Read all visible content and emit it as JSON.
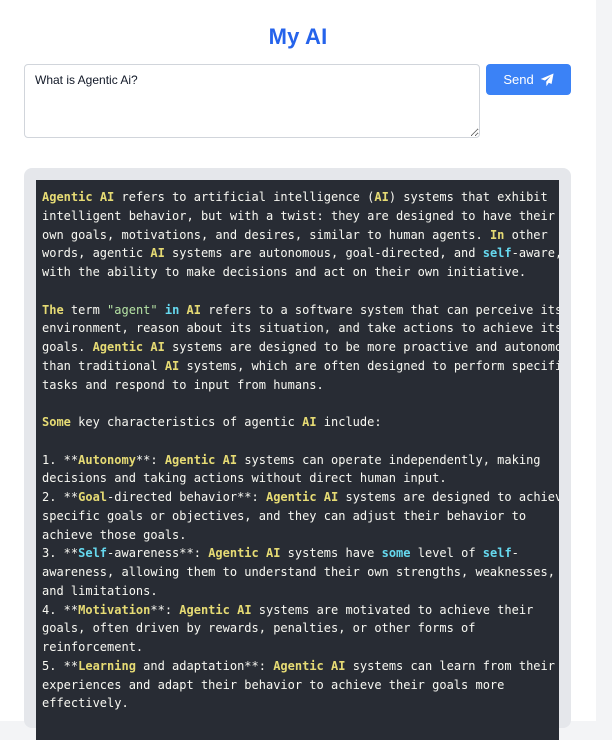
{
  "header": {
    "title": "My AI"
  },
  "prompt": {
    "value": "What is Agentic Ai?",
    "placeholder": ""
  },
  "send_button": {
    "label": "Send",
    "icon": "paper-plane-icon"
  },
  "colors": {
    "title": "#2563eb",
    "button": "#3b82f6",
    "code_bg": "#282c34",
    "highlight_yellow": "#e6db74",
    "highlight_blue": "#66d9ef"
  },
  "response_lines": [
    [
      {
        "t": "Agentic",
        "c": "y"
      },
      {
        "t": " "
      },
      {
        "t": "AI",
        "c": "y"
      },
      {
        "t": " refers to artificial intelligence ("
      },
      {
        "t": "AI",
        "c": "y"
      },
      {
        "t": ") systems that exhibit"
      }
    ],
    [
      {
        "t": "intelligent behavior, but with a twist: they are designed to have their"
      }
    ],
    [
      {
        "t": "own goals, motivations, and desires, similar to human agents. "
      },
      {
        "t": "In",
        "c": "y"
      },
      {
        "t": " other"
      }
    ],
    [
      {
        "t": "words, agentic "
      },
      {
        "t": "AI",
        "c": "y"
      },
      {
        "t": " systems are autonomous, goal-directed, and "
      },
      {
        "t": "self",
        "c": "b"
      },
      {
        "t": "-aware,"
      }
    ],
    [
      {
        "t": "with the ability to make decisions and act on their own initiative."
      }
    ],
    [
      {
        "t": ""
      }
    ],
    [
      {
        "t": "The",
        "c": "y"
      },
      {
        "t": " term "
      },
      {
        "t": "\"agent\"",
        "c": "s"
      },
      {
        "t": " "
      },
      {
        "t": "in",
        "c": "b"
      },
      {
        "t": " "
      },
      {
        "t": "AI",
        "c": "y"
      },
      {
        "t": " refers to a software system that can perceive its"
      }
    ],
    [
      {
        "t": "environment, reason about its situation, and take actions to achieve its"
      }
    ],
    [
      {
        "t": "goals. "
      },
      {
        "t": "Agentic",
        "c": "y"
      },
      {
        "t": " "
      },
      {
        "t": "AI",
        "c": "y"
      },
      {
        "t": " systems are designed to be more proactive and autonomous"
      }
    ],
    [
      {
        "t": "than traditional "
      },
      {
        "t": "AI",
        "c": "y"
      },
      {
        "t": " systems, which are often designed to perform specific"
      }
    ],
    [
      {
        "t": "tasks and respond to input from humans."
      }
    ],
    [
      {
        "t": ""
      }
    ],
    [
      {
        "t": "Some",
        "c": "y"
      },
      {
        "t": " key characteristics of agentic "
      },
      {
        "t": "AI",
        "c": "y"
      },
      {
        "t": " include:"
      }
    ],
    [
      {
        "t": ""
      }
    ],
    [
      {
        "t": "1. **"
      },
      {
        "t": "Autonomy",
        "c": "y"
      },
      {
        "t": "**: "
      },
      {
        "t": "Agentic",
        "c": "y"
      },
      {
        "t": " "
      },
      {
        "t": "AI",
        "c": "y"
      },
      {
        "t": " systems can operate independently, making"
      }
    ],
    [
      {
        "t": "decisions and taking actions without direct human input."
      }
    ],
    [
      {
        "t": "2. **"
      },
      {
        "t": "Goal",
        "c": "y"
      },
      {
        "t": "-directed behavior**: "
      },
      {
        "t": "Agentic",
        "c": "y"
      },
      {
        "t": " "
      },
      {
        "t": "AI",
        "c": "y"
      },
      {
        "t": " systems are designed to achieve"
      }
    ],
    [
      {
        "t": "specific goals or objectives, and they can adjust their behavior to"
      }
    ],
    [
      {
        "t": "achieve those goals."
      }
    ],
    [
      {
        "t": "3. **"
      },
      {
        "t": "Self",
        "c": "b"
      },
      {
        "t": "-awareness**: "
      },
      {
        "t": "Agentic",
        "c": "y"
      },
      {
        "t": " "
      },
      {
        "t": "AI",
        "c": "y"
      },
      {
        "t": " systems have "
      },
      {
        "t": "some",
        "c": "b"
      },
      {
        "t": " level of "
      },
      {
        "t": "self",
        "c": "b"
      },
      {
        "t": "-"
      }
    ],
    [
      {
        "t": "awareness, allowing them to understand their own strengths, weaknesses,"
      }
    ],
    [
      {
        "t": "and limitations."
      }
    ],
    [
      {
        "t": "4. **"
      },
      {
        "t": "Motivation",
        "c": "y"
      },
      {
        "t": "**: "
      },
      {
        "t": "Agentic",
        "c": "y"
      },
      {
        "t": " "
      },
      {
        "t": "AI",
        "c": "y"
      },
      {
        "t": " systems are motivated to achieve their"
      }
    ],
    [
      {
        "t": "goals, often driven by rewards, penalties, or other forms of"
      }
    ],
    [
      {
        "t": "reinforcement."
      }
    ],
    [
      {
        "t": "5. **"
      },
      {
        "t": "Learning",
        "c": "y"
      },
      {
        "t": " and adaptation**: "
      },
      {
        "t": "Agentic",
        "c": "y"
      },
      {
        "t": " "
      },
      {
        "t": "AI",
        "c": "y"
      },
      {
        "t": " systems can learn from their"
      }
    ],
    [
      {
        "t": "experiences and adapt their behavior to achieve their goals more"
      }
    ],
    [
      {
        "t": "effectively."
      }
    ],
    [
      {
        "t": ""
      }
    ]
  ]
}
